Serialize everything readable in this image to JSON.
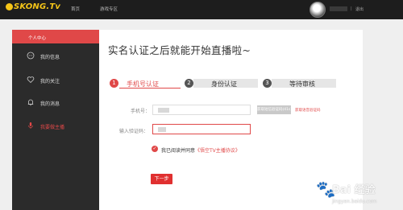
{
  "header": {
    "logo_text": "SKONG.Tv",
    "nav": [
      "首页",
      "游戏专区"
    ],
    "separator": "|",
    "logout": "退出"
  },
  "sidebar": {
    "title": "个人中心",
    "items": [
      {
        "label": "我的信息",
        "icon": "chat-bubble-icon",
        "active": false
      },
      {
        "label": "我的关注",
        "icon": "heart-icon",
        "active": false
      },
      {
        "label": "我的消息",
        "icon": "bell-icon",
        "active": false
      },
      {
        "label": "我要做主播",
        "icon": "microphone-icon",
        "active": true
      }
    ]
  },
  "main": {
    "title": "实名认证之后就能开始直播啦~",
    "steps": [
      {
        "num": "1",
        "label": "手机号认证",
        "active": true
      },
      {
        "num": "2",
        "label": "身份认证",
        "active": false
      },
      {
        "num": "3",
        "label": "等待审核",
        "active": false
      }
    ],
    "form": {
      "phone_label": "手机号：",
      "code_label": "输入验证码：",
      "send_code_button": "获取短信验证码(41s)",
      "voice_code_link": "获取语音验证码",
      "agree_prefix": "我已阅读并同意",
      "agree_link": "《悟空TV主播协议》",
      "next_button": "下一步"
    }
  },
  "watermark": {
    "brand": "Bai 经验",
    "url": "jingyan.baidu.com"
  },
  "colors": {
    "accent": "#e04848",
    "topbar": "#1d1d1d",
    "sidebar": "#2b2b2b"
  }
}
